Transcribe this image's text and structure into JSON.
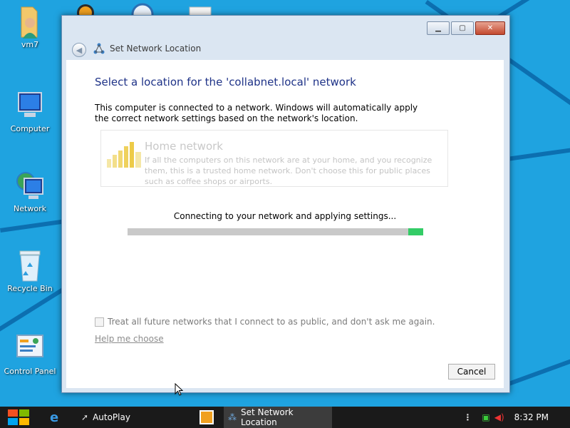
{
  "desktop": {
    "icons": [
      {
        "label": "vm7",
        "icon": "user-folder-icon"
      },
      {
        "label": "Computer",
        "icon": "computer-icon"
      },
      {
        "label": "Network",
        "icon": "network-icon"
      },
      {
        "label": "Recycle Bin",
        "icon": "recycle-bin-icon"
      },
      {
        "label": "Control Panel",
        "icon": "control-panel-icon"
      }
    ]
  },
  "window": {
    "title": "Set Network Location",
    "heading": "Select a location for the 'collabnet.local' network",
    "description": "This computer is connected to a network. Windows will automatically apply the correct network settings based on the network's location.",
    "option": {
      "title": "Home network",
      "description": "If all the computers on this network are at your home, and you recognize them, this is a trusted home network.  Don't choose this for public places such as coffee shops or airports."
    },
    "status": "Connecting to your network and applying settings...",
    "progress": {
      "chunk_start": 0.95,
      "chunk_end": 1.0
    },
    "checkbox_label": "Treat all future networks that I connect to as public, and don't ask me again.",
    "checkbox_checked": false,
    "help_link": "Help me choose",
    "cancel_label": "Cancel",
    "controls": {
      "minimize": "minimize-icon",
      "maximize": "maximize-icon",
      "close": "close-icon"
    }
  },
  "taskbar": {
    "items": [
      {
        "label": "AutoPlay",
        "icon": "autoplay-icon"
      },
      {
        "label": "Set Network Location",
        "icon": "network-icon",
        "active": true
      }
    ],
    "clock": "8:32 PM"
  },
  "colors": {
    "desktop": "#1fa3e0",
    "heading": "#1e3287",
    "progress_chunk": "#33cc66",
    "taskbar": "#1a1a1a"
  }
}
